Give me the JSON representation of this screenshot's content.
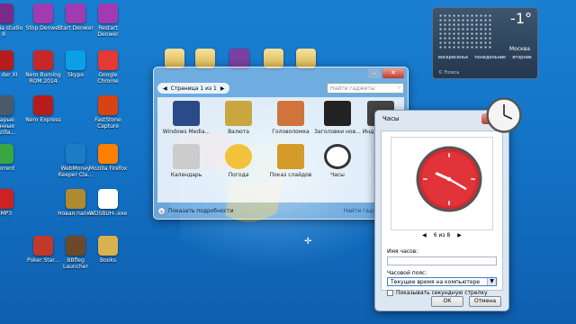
{
  "desktop": {
    "icons": [
      {
        "label": "antasia studio 8",
        "color": "#7a2b8a"
      },
      {
        "label": "Stop Denwer",
        "color": "#a23bb2"
      },
      {
        "label": "Start Denwer",
        "color": "#a23bb2"
      },
      {
        "label": "Restart Denwer",
        "color": "#a23bb2"
      },
      {
        "label": "obe der XI",
        "color": "#b71c1c"
      },
      {
        "label": "Nero Burning ROM 2014",
        "color": "#c62828"
      },
      {
        "label": "Skype",
        "color": "#0aa0e8"
      },
      {
        "label": "Google Chrome",
        "color": "#e53935"
      },
      {
        "label": "Старые данные Mozilla...",
        "color": "#4a5a6a"
      },
      {
        "label": "Nero Express",
        "color": "#b71c1c"
      },
      {
        "label": "FastStone Capture",
        "color": "#d84315"
      },
      {
        "label": "uTorrent",
        "color": "#3aa642"
      },
      {
        "label": "WebMoney Keeper Cla...",
        "color": "#1b7dc6"
      },
      {
        "label": "Mozilla Firefox",
        "color": "#ff7f00"
      },
      {
        "label": "AIMP3",
        "color": "#cc2222"
      },
      {
        "label": "Новая папка",
        "color": "#b08a2e"
      },
      {
        "label": "WDSBUH-.exe",
        "color": "#ffffff"
      },
      {
        "label": "Poker Star...",
        "color": "#c0392b"
      },
      {
        "label": "BBfleg Launcher",
        "color": "#6a4a2a"
      },
      {
        "label": "Books",
        "color": "#d8b24e"
      }
    ]
  },
  "weather": {
    "temp": "-1°",
    "city": "Москва",
    "days": [
      "воскресенье",
      "понедельник",
      "вторник"
    ],
    "provider": "© Foreca"
  },
  "gadgets_window": {
    "page_label": "Страница 1 из 1",
    "search_placeholder": "Найти гаджеты",
    "items": [
      {
        "label": "Windows Media...",
        "color": "#2b4a8a"
      },
      {
        "label": "Валюта",
        "color": "#c9a640"
      },
      {
        "label": "Головоломка",
        "color": "#d0743c"
      },
      {
        "label": "Заголовки нов...",
        "color": "#222"
      },
      {
        "label": "Индикатор...",
        "color": "#444"
      },
      {
        "label": "Календарь",
        "color": "#cccccc"
      },
      {
        "label": "Погода",
        "color": "#f2c23a"
      },
      {
        "label": "Показ слайдов",
        "color": "#d49a2a"
      },
      {
        "label": "Часы",
        "color": "#333"
      }
    ],
    "details_label": "Показать подробности",
    "online_label": "Найти гаджеты в И..."
  },
  "clock_dialog": {
    "title": "Часы",
    "pager": "6 из 8",
    "name_label": "Имя часов:",
    "name_value": "",
    "tz_label": "Часовой пояс:",
    "tz_value": "Текущее время на компьютере",
    "seconds_label": "Показывать секундную стрелку",
    "ok_label": "ОК",
    "cancel_label": "Отмена"
  }
}
